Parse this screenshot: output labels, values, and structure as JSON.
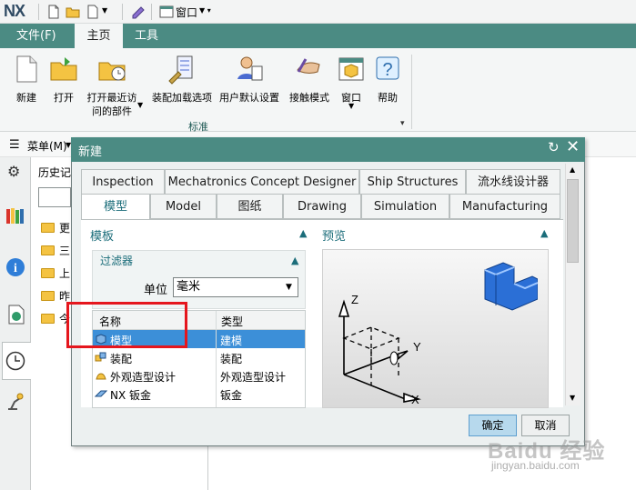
{
  "app": {
    "logo": "NX",
    "window_menu": "窗口"
  },
  "ribbon": {
    "tabs": [
      "文件(F)",
      "主页",
      "工具"
    ],
    "active_tab": "主页",
    "buttons": [
      {
        "label": "新建"
      },
      {
        "label": "打开"
      },
      {
        "label": "打开最近访\n问的部件"
      },
      {
        "label": "装配加载选项"
      },
      {
        "label": "用户默认设置"
      },
      {
        "label": "接触模式"
      },
      {
        "label": "窗口"
      },
      {
        "label": "帮助"
      }
    ],
    "group_label": "标准"
  },
  "menubar": {
    "menu_label": "菜单(M)"
  },
  "navigator": {
    "title": "历史记",
    "rows": [
      "更",
      "三",
      "上",
      "昨",
      "今"
    ]
  },
  "dialog": {
    "title": "新建",
    "tabs_row1": [
      "Inspection",
      "Mechatronics Concept Designer",
      "Ship Structures",
      "流水线设计器"
    ],
    "tabs_row2": [
      "模型",
      "Model",
      "图纸",
      "Drawing",
      "Simulation",
      "Manufacturing"
    ],
    "active_tab": "模型",
    "templates_section": "模板",
    "preview_section": "预览",
    "filter_section": "过滤器",
    "unit_label": "单位",
    "unit_value": "毫米",
    "columns": [
      "名称",
      "类型"
    ],
    "rows": [
      {
        "name": "模型",
        "type": "建模",
        "selected": true
      },
      {
        "name": "装配",
        "type": "装配",
        "selected": false
      },
      {
        "name": "外观造型设计",
        "type": "外观造型设计",
        "selected": false
      },
      {
        "name": "NX 钣金",
        "type": "钣金",
        "selected": false
      }
    ],
    "ok_label": "确定",
    "cancel_label": "取消",
    "axis_labels": {
      "z": "Z",
      "y": "Y",
      "x": "X"
    }
  },
  "watermark": {
    "main": "Baidu 经验",
    "sub": "jingyan.baidu.com"
  },
  "colors": {
    "accent": "#4b8b83",
    "selection": "#3c8fd8",
    "highlight_box": "#e5161d"
  }
}
